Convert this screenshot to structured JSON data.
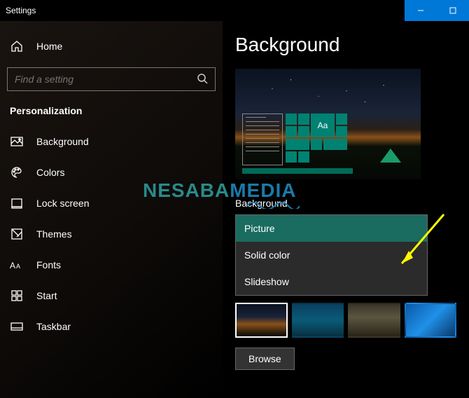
{
  "window": {
    "title": "Settings"
  },
  "sidebar": {
    "home_label": "Home",
    "search_placeholder": "Find a setting",
    "section": "Personalization",
    "items": [
      {
        "label": "Background"
      },
      {
        "label": "Colors"
      },
      {
        "label": "Lock screen"
      },
      {
        "label": "Themes"
      },
      {
        "label": "Fonts"
      },
      {
        "label": "Start"
      },
      {
        "label": "Taskbar"
      }
    ]
  },
  "main": {
    "title": "Background",
    "preview_tile_text": "Aa",
    "field_label": "Background",
    "dropdown_options": [
      {
        "label": "Picture",
        "selected": true
      },
      {
        "label": "Solid color",
        "selected": false
      },
      {
        "label": "Slideshow",
        "selected": false
      }
    ],
    "browse_label": "Browse"
  },
  "watermark": {
    "part1": "NESABA",
    "part2": "MEDIA"
  }
}
